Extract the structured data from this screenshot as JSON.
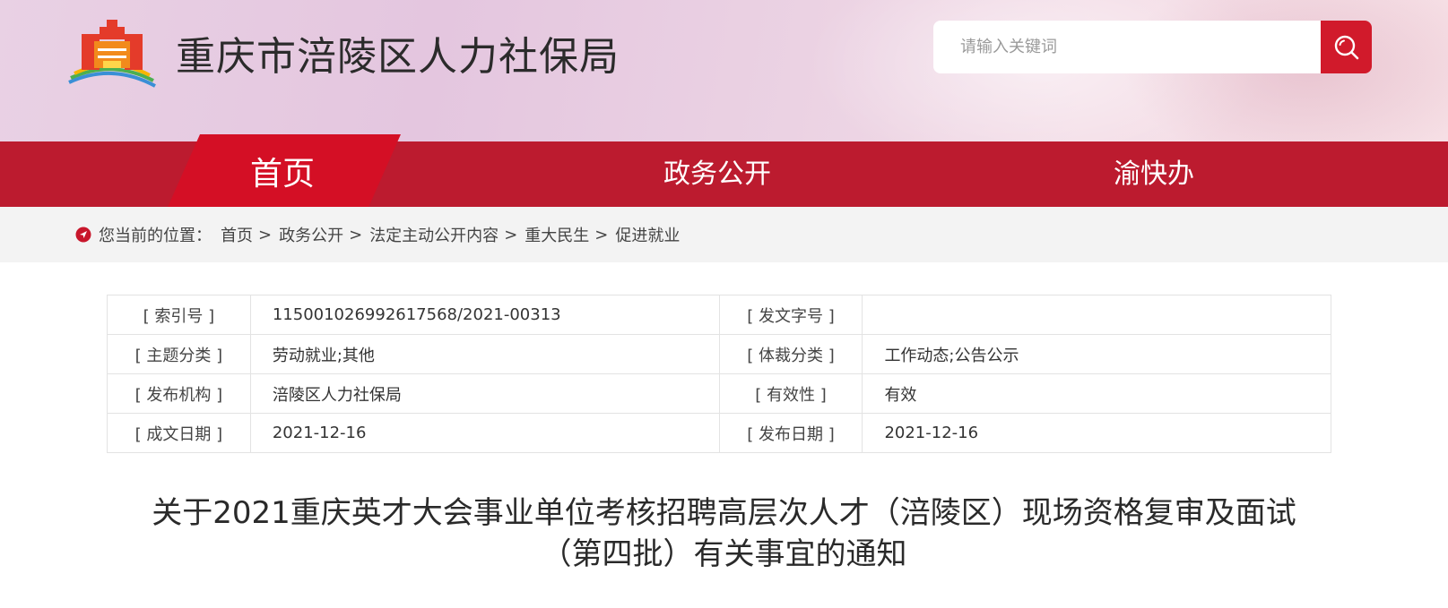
{
  "header": {
    "site_title": "重庆市涪陵区人力社保局",
    "search_placeholder": "请输入关键词",
    "colors": {
      "accent": "#d11a2b",
      "nav": "#bc1b2f"
    }
  },
  "nav": {
    "items": [
      {
        "label": "首页",
        "active": true
      },
      {
        "label": "政务公开",
        "active": false
      },
      {
        "label": "渝快办",
        "active": false
      }
    ]
  },
  "breadcrumb": {
    "prefix": "您当前的位置：",
    "items": [
      "首页",
      "政务公开",
      "法定主动公开内容",
      "重大民生",
      "促进就业"
    ],
    "separator": ">"
  },
  "info_table": {
    "rows": [
      [
        {
          "label": "[ 索引号 ]",
          "value": "115001026992617568/2021-00313"
        },
        {
          "label": "[ 发文字号 ]",
          "value": ""
        }
      ],
      [
        {
          "label": "[ 主题分类 ]",
          "value": "劳动就业;其他"
        },
        {
          "label": "[ 体裁分类 ]",
          "value": "工作动态;公告公示"
        }
      ],
      [
        {
          "label": "[ 发布机构 ]",
          "value": "涪陵区人力社保局"
        },
        {
          "label": "[ 有效性 ]",
          "value": "有效"
        }
      ],
      [
        {
          "label": "[ 成文日期 ]",
          "value": "2021-12-16"
        },
        {
          "label": "[ 发布日期 ]",
          "value": "2021-12-16"
        }
      ]
    ]
  },
  "article": {
    "title_line1": "关于2021重庆英才大会事业单位考核招聘高层次人才（涪陵区）现场资格复审及面试",
    "title_line2": "（第四批）有关事宜的通知"
  },
  "icons": {
    "logo": "tiananmen-logo-icon",
    "search": "search-icon",
    "location": "location-pin-icon"
  }
}
